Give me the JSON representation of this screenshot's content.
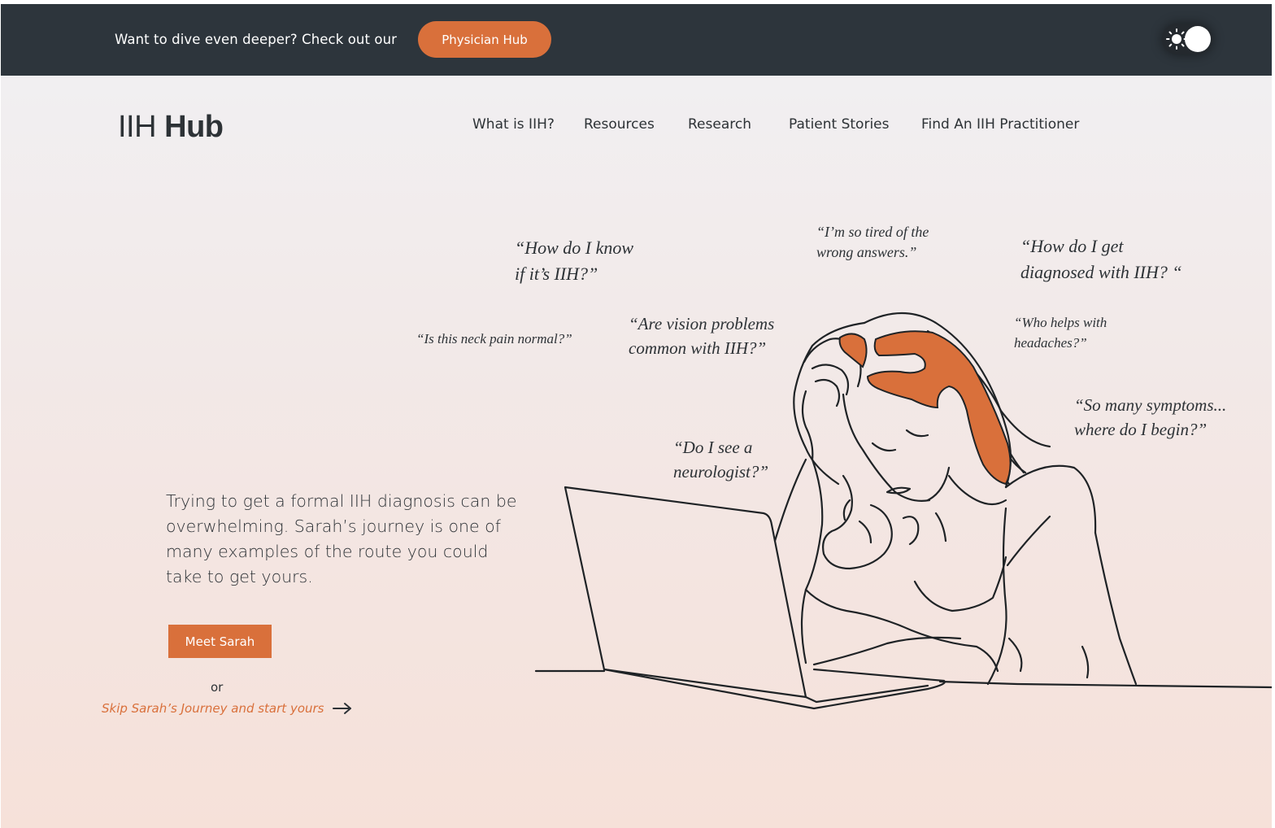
{
  "banner": {
    "text": "Want to dive even deeper? Check out our",
    "button_label": "Physician Hub"
  },
  "theme_toggle": {
    "icon": "sun-icon",
    "state": "light"
  },
  "logo": {
    "part1": "IIH",
    "part2": "Hub"
  },
  "nav": {
    "items": [
      {
        "label": "What is IIH?"
      },
      {
        "label": "Resources"
      },
      {
        "label": "Research"
      },
      {
        "label": "Patient Stories"
      },
      {
        "label": "Find An IIH Practitioner"
      }
    ]
  },
  "hero": {
    "text": "Trying to get a formal IIH diagnosis can be overwhelming. Sarah’s journey is one of many examples of the route you could take to get yours.",
    "button_label": "Meet Sarah",
    "or_text": "or",
    "skip_link": "Skip Sarah’s Journey and start yours",
    "skip_icon": "arrow-right-icon"
  },
  "quotes": [
    {
      "text": "“How do I know\nif it’s IIH?”"
    },
    {
      "text": "“I’m so tired of the\nwrong answers.”"
    },
    {
      "text": "“How do I get\ndiagnosed with IIH? “"
    },
    {
      "text": "“Is this neck pain normal?”"
    },
    {
      "text": "“Are vision problems\ncommon with IIH?”"
    },
    {
      "text": "“Who helps with\nheadaches?”"
    },
    {
      "text": "“So many symptoms...\nwhere do I begin?”"
    },
    {
      "text": "“Do I see a\nneurologist?”"
    }
  ],
  "colors": {
    "accent": "#d9703b",
    "banner_bg": "#2d353c",
    "text_dark": "#2d3236"
  }
}
